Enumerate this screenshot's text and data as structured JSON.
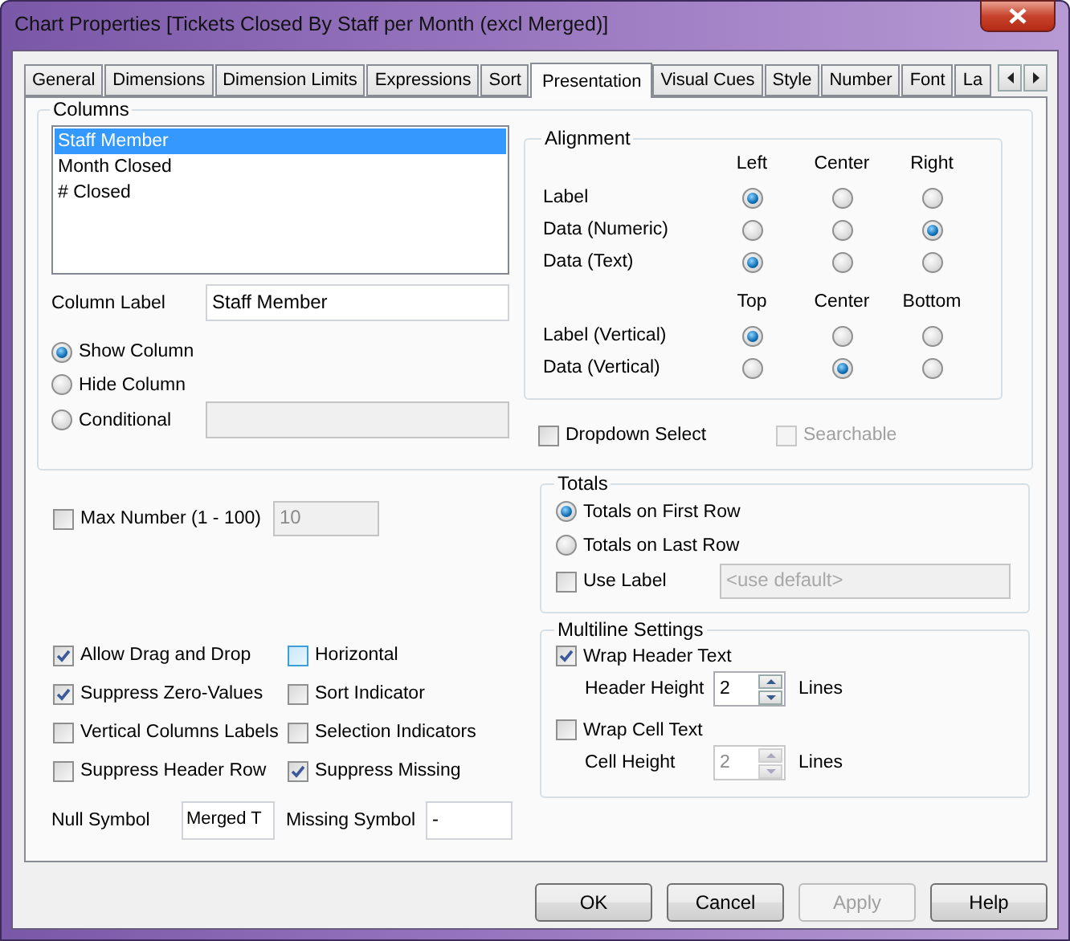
{
  "window": {
    "title": "Chart Properties [Tickets Closed By Staff per Month (excl Merged)]"
  },
  "tabs": [
    {
      "label": "General",
      "selected": false
    },
    {
      "label": "Dimensions",
      "selected": false
    },
    {
      "label": "Dimension Limits",
      "selected": false
    },
    {
      "label": "Expressions",
      "selected": false
    },
    {
      "label": "Sort",
      "selected": false
    },
    {
      "label": "Presentation",
      "selected": true
    },
    {
      "label": "Visual Cues",
      "selected": false
    },
    {
      "label": "Style",
      "selected": false
    },
    {
      "label": "Number",
      "selected": false
    },
    {
      "label": "Font",
      "selected": false
    },
    {
      "label": "La",
      "selected": false
    }
  ],
  "columns": {
    "legend": "Columns",
    "items": [
      {
        "label": "Staff Member",
        "selected": true
      },
      {
        "label": "Month Closed",
        "selected": false
      },
      {
        "label": "# Closed",
        "selected": false
      }
    ],
    "column_label": {
      "label": "Column Label",
      "value": "Staff Member"
    },
    "visibility": [
      {
        "label": "Show Column",
        "selected": true
      },
      {
        "label": "Hide Column",
        "selected": false
      },
      {
        "label": "Conditional",
        "selected": false
      }
    ]
  },
  "alignment": {
    "legend": "Alignment",
    "horizontal_headers": [
      "Left",
      "Center",
      "Right"
    ],
    "horizontal_rows": [
      {
        "label": "Label",
        "options": [
          {
            "selected": true
          },
          {
            "selected": false
          },
          {
            "selected": false
          }
        ]
      },
      {
        "label": "Data (Numeric)",
        "options": [
          {
            "selected": false
          },
          {
            "selected": false
          },
          {
            "selected": true
          }
        ]
      },
      {
        "label": "Data (Text)",
        "options": [
          {
            "selected": true
          },
          {
            "selected": false
          },
          {
            "selected": false
          }
        ]
      }
    ],
    "vertical_headers": [
      "Top",
      "Center",
      "Bottom"
    ],
    "vertical_rows": [
      {
        "label": "Label (Vertical)",
        "options": [
          {
            "selected": true
          },
          {
            "selected": false
          },
          {
            "selected": false
          }
        ]
      },
      {
        "label": "Data (Vertical)",
        "options": [
          {
            "selected": false
          },
          {
            "selected": true
          },
          {
            "selected": false
          }
        ]
      }
    ]
  },
  "dropdown_select": {
    "label": "Dropdown Select",
    "checked": false
  },
  "searchable": {
    "label": "Searchable",
    "checked": false,
    "disabled": true
  },
  "max_number": {
    "label": "Max Number (1 - 100)",
    "checked": false,
    "value": "10"
  },
  "options": [
    {
      "label": "Allow Drag and Drop",
      "checked": true,
      "hovered": false
    },
    {
      "label": "Horizontal",
      "checked": false,
      "hovered": true
    },
    {
      "label": "Suppress Zero-Values",
      "checked": true,
      "hovered": false
    },
    {
      "label": "Sort Indicator",
      "checked": false,
      "hovered": false
    },
    {
      "label": "Vertical Columns Labels",
      "checked": false,
      "hovered": false
    },
    {
      "label": "Selection Indicators",
      "checked": false,
      "hovered": false
    },
    {
      "label": "Suppress Header Row",
      "checked": false,
      "hovered": false
    },
    {
      "label": "Suppress Missing",
      "checked": true,
      "hovered": false
    }
  ],
  "null_symbol": {
    "label": "Null Symbol",
    "value": "Merged T"
  },
  "missing_symbol": {
    "label": "Missing Symbol",
    "value": "-"
  },
  "totals": {
    "legend": "Totals",
    "options": [
      {
        "label": "Totals on First Row",
        "selected": true
      },
      {
        "label": "Totals on Last Row",
        "selected": false
      }
    ],
    "use_label": {
      "label": "Use Label",
      "checked": false
    },
    "label_field": {
      "placeholder": "<use default>"
    }
  },
  "multiline": {
    "legend": "Multiline Settings",
    "rows": [
      {
        "label": "Wrap Header Text",
        "checked": true,
        "height_label": "Header Height",
        "value": "2",
        "unit": "Lines"
      },
      {
        "label": "Wrap Cell Text",
        "checked": false,
        "height_label": "Cell Height",
        "value": "2",
        "unit": "Lines"
      }
    ]
  },
  "buttons": [
    {
      "label": "OK",
      "disabled": false
    },
    {
      "label": "Cancel",
      "disabled": false
    },
    {
      "label": "Apply",
      "disabled": true
    },
    {
      "label": "Help",
      "disabled": false
    }
  ]
}
